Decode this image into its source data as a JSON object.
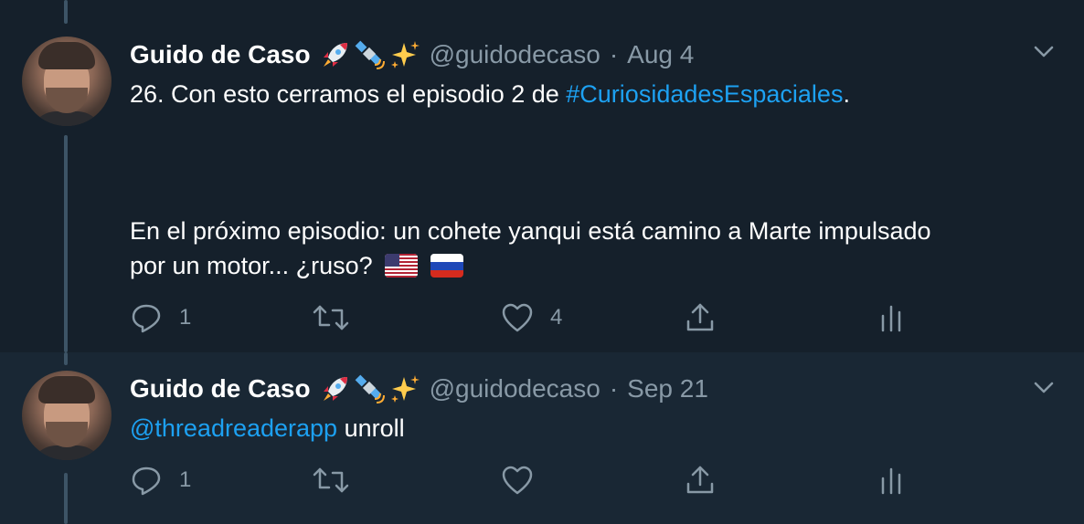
{
  "tweets": [
    {
      "author_name": "Guido de Caso",
      "handle": "@guidodecaso",
      "separator": "·",
      "date": "Aug 4",
      "text_prefix": "26. Con esto cerramos el episodio 2 de ",
      "hashtag": "#CuriosidadesEspaciales",
      "text_suffix": ".",
      "text_line2": "En el próximo episodio: un cohete yanqui está camino a Marte impulsado",
      "text_line3": "por un motor... ¿ruso?",
      "reply_count": "1",
      "retweet_count": "",
      "like_count": "4"
    },
    {
      "author_name": "Guido de Caso",
      "handle": "@guidodecaso",
      "separator": "·",
      "date": "Sep 21",
      "mention": "@threadreaderapp",
      "text_after_mention": " unroll",
      "reply_count": "1",
      "retweet_count": "",
      "like_count": ""
    }
  ],
  "icons": {
    "name_emojis": [
      "rocket-icon",
      "satellite-icon",
      "sparkles-icon"
    ],
    "flags": [
      "us-flag-icon",
      "russia-flag-icon"
    ],
    "actions": [
      "reply-icon",
      "retweet-icon",
      "like-icon",
      "share-icon",
      "analytics-icon"
    ]
  },
  "colors": {
    "background": "#15202b",
    "background_alt": "#192734",
    "text": "#ffffff",
    "secondary": "#8899a6",
    "link": "#1da1f2"
  }
}
